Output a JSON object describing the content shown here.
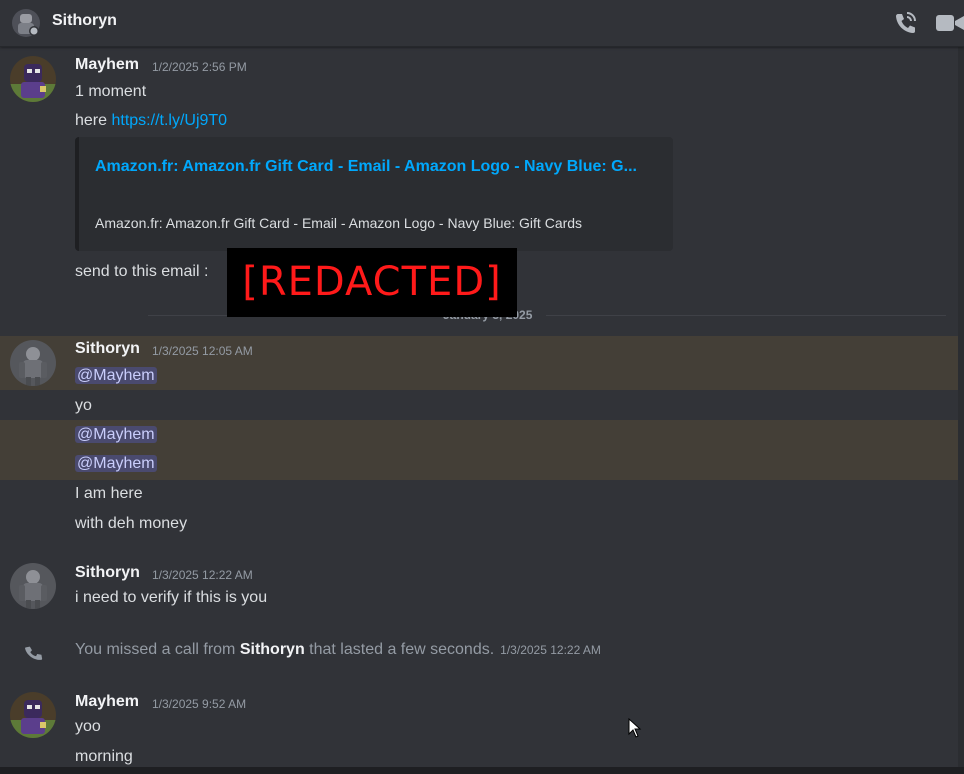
{
  "header": {
    "title": "Sithoryn",
    "avatar_icon": "bot-avatar-icon",
    "call_icon": "phone-call-icon",
    "video_icon": "video-camera-icon"
  },
  "colors": {
    "background": "#313338",
    "link": "#00a8fc",
    "mention_bg": "#5865f2",
    "redacted_text": "#ff1a1a"
  },
  "messages": [
    {
      "author": "Mayhem",
      "timestamp": "1/2/2025 2:56 PM",
      "lines": [
        "1 moment",
        "here",
        "send to this email :"
      ],
      "link": "https://t.ly/Uj9T0",
      "embed": {
        "title": "Amazon.fr: Amazon.fr Gift Card - Email - Amazon Logo - Navy Blue: G...",
        "description": "Amazon.fr: Amazon.fr Gift Card - Email - Amazon Logo - Navy Blue: Gift Cards"
      }
    },
    {
      "author": "Sithoryn",
      "timestamp": "1/3/2025 12:05 AM",
      "lines": [
        "@Mayhem",
        "yo",
        "@Mayhem",
        "@Mayhem",
        "I am here",
        "with deh money"
      ]
    },
    {
      "author": "Sithoryn",
      "timestamp": "1/3/2025 12:22 AM",
      "lines": [
        "i need to verify if this is you"
      ]
    },
    {
      "author": "Mayhem",
      "timestamp": "1/3/2025 9:52 AM",
      "lines": [
        "yoo",
        "morning"
      ]
    }
  ],
  "divider": "January 3, 2025",
  "redaction": "[REDACTED]",
  "system": {
    "prefix": "You missed a call from",
    "caller": "Sithoryn",
    "suffix": "that lasted a few seconds.",
    "timestamp": "1/3/2025 12:22 AM"
  }
}
